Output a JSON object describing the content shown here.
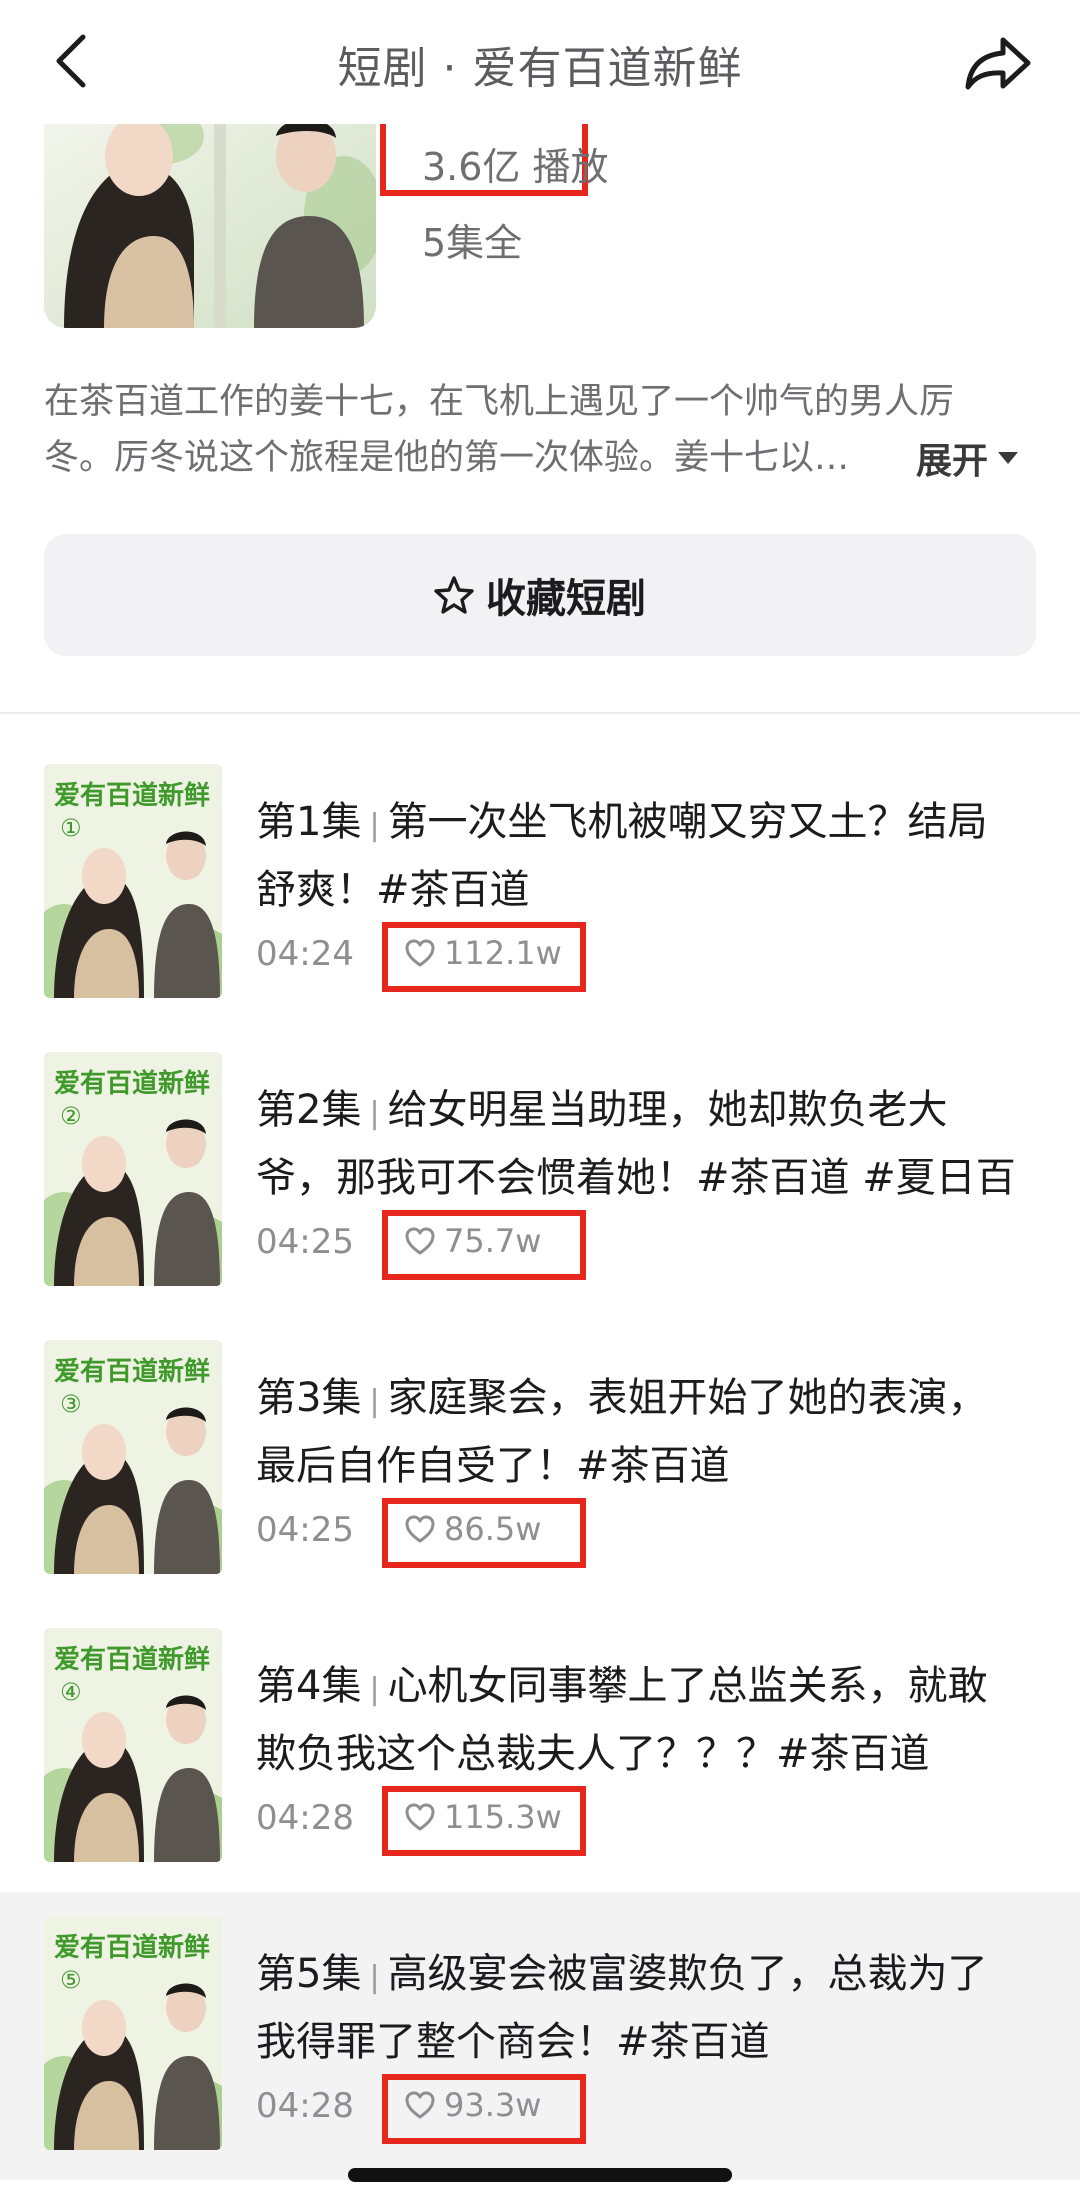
{
  "nav": {
    "title": "短剧 · 爱有百道新鲜",
    "back_icon": "chevron-left-icon",
    "share_icon": "share-arrow-icon"
  },
  "drama": {
    "plays": "3.6亿 播放",
    "episodes_total": "5集全",
    "description_lines": [
      "在茶百道工作的姜十七，在飞机上遇见了一个帅气的男人厉",
      "冬。厉冬说这个旅程是他的第一次体验。姜十七以…"
    ],
    "expand_label": "展开",
    "expand_icon": "caret-down-icon",
    "favorite_label": "收藏短剧",
    "favorite_icon": "star-outline-icon"
  },
  "episodes": [
    {
      "number": "第1集",
      "separator": "|",
      "title_lines": [
        "第一次坐飞机被嘲又穷又土？结局",
        "舒爽！#茶百道"
      ],
      "duration": "04:24",
      "likes": "112.1w",
      "thumb_badge": "①",
      "thumb_logo": "爱有百道新鲜"
    },
    {
      "number": "第2集",
      "separator": "|",
      "title_lines": [
        "给女明星当助理，她却欺负老大",
        "爷，那我可不会惯着她！#茶百道 #夏日百"
      ],
      "duration": "04:25",
      "likes": "75.7w",
      "thumb_badge": "②",
      "thumb_logo": "爱有百道新鲜"
    },
    {
      "number": "第3集",
      "separator": "|",
      "title_lines": [
        "家庭聚会，表姐开始了她的表演，",
        "最后自作自受了！#茶百道"
      ],
      "duration": "04:25",
      "likes": "86.5w",
      "thumb_badge": "③",
      "thumb_logo": "爱有百道新鲜"
    },
    {
      "number": "第4集",
      "separator": "|",
      "title_lines": [
        "心机女同事攀上了总监关系，就敢",
        "欺负我这个总裁夫人了？？？#茶百道"
      ],
      "duration": "04:28",
      "likes": "115.3w",
      "thumb_badge": "④",
      "thumb_logo": "爱有百道新鲜"
    },
    {
      "number": "第5集",
      "separator": "|",
      "title_lines": [
        "高级宴会被富婆欺负了，总裁为了",
        "我得罪了整个商会！#茶百道"
      ],
      "duration": "04:28",
      "likes": "93.3w",
      "thumb_badge": "⑤",
      "thumb_logo": "爱有百道新鲜",
      "active": true
    }
  ],
  "colors": {
    "highlight_box": "#e8271c",
    "active_row_bg": "#f3f3f3",
    "button_bg": "#f2f2f5",
    "thumb_logo_green": "#3f9a2b"
  },
  "like_icon": "heart-outline-icon"
}
